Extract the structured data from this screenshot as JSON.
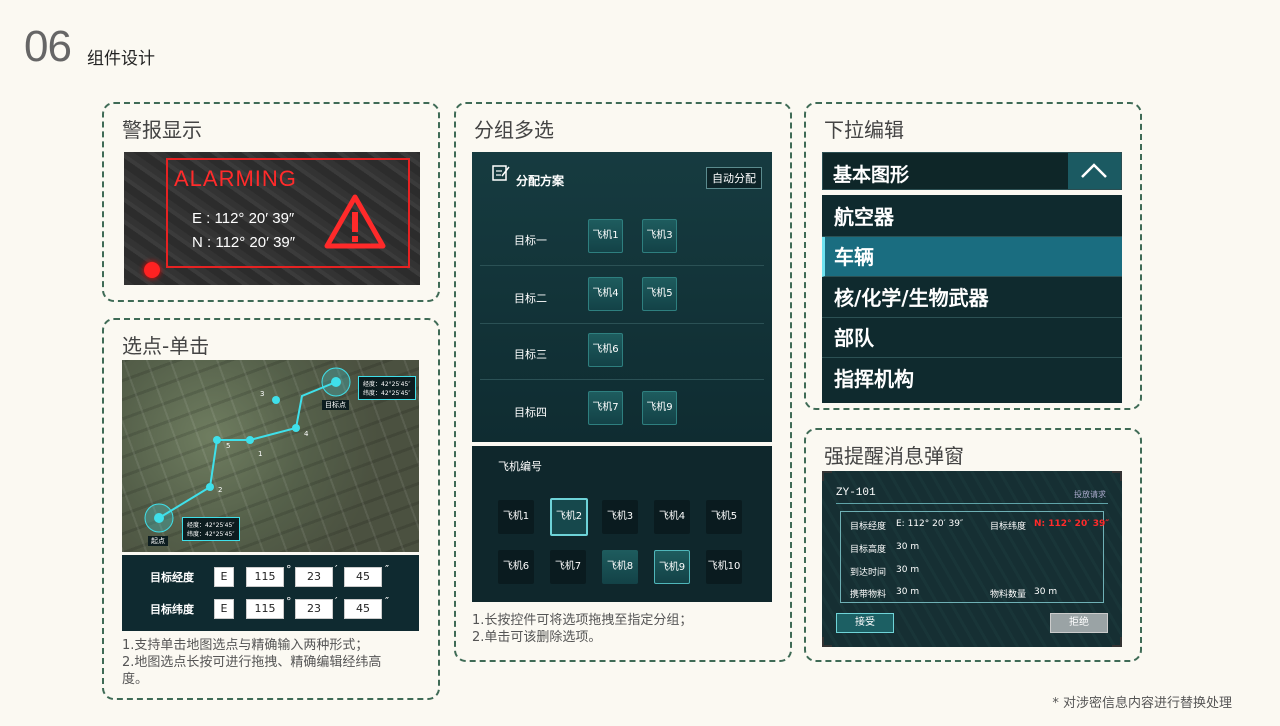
{
  "header": {
    "number": "06",
    "title": "组件设计"
  },
  "footnote": "* 对涉密信息内容进行替换处理",
  "alarm_card": {
    "title": "警报显示",
    "alarm_text": "ALARMING",
    "coord_e": "E : 112° 20′ 39″",
    "coord_n": "N : 112° 20′ 39″"
  },
  "point_card": {
    "title": "选点-单击",
    "map": {
      "start_label": "起点",
      "target_label": "目标点",
      "lon_label": "经度：42°25′45″",
      "lat_label": "纬度：42°25′45″",
      "waypoints": [
        "1",
        "2",
        "3",
        "4",
        "5"
      ]
    },
    "lon_row": {
      "label": "目标经度",
      "dir": "E",
      "deg": "115",
      "min": "23",
      "sec": "45",
      "u1": "°",
      "u2": "′",
      "u3": "″"
    },
    "lat_row": {
      "label": "目标纬度",
      "dir": "E",
      "deg": "115",
      "min": "23",
      "sec": "45",
      "u1": "°",
      "u2": "′",
      "u3": "″"
    },
    "notes": [
      "1.支持单击地图选点与精确输入两种形式；",
      "2.地图选点长按可进行拖拽、精确编辑经纬高",
      "度。"
    ]
  },
  "group_card": {
    "title": "分组多选",
    "panel_title": "分配方案",
    "auto_button": "自动分配",
    "groups": [
      {
        "label": "目标一",
        "planes": [
          "飞机1",
          "飞机3"
        ]
      },
      {
        "label": "目标二",
        "planes": [
          "飞机4",
          "飞机5"
        ]
      },
      {
        "label": "目标三",
        "planes": [
          "飞机6"
        ]
      },
      {
        "label": "目标四",
        "planes": [
          "飞机7",
          "飞机9"
        ]
      }
    ],
    "pool_title": "飞机编号",
    "pool": [
      "飞机1",
      "飞机2",
      "飞机3",
      "飞机4",
      "飞机5",
      "飞机6",
      "飞机7",
      "飞机8",
      "飞机9",
      "飞机10"
    ],
    "notes": [
      "1.长按控件可将选项拖拽至指定分组；",
      "2.单击可该删除选项。"
    ]
  },
  "dropdown_card": {
    "title": "下拉编辑",
    "selected": "基本图形",
    "items": [
      "航空器",
      "车辆",
      "核/化学/生物武器",
      "部队",
      "指挥机构"
    ],
    "active_item": "车辆"
  },
  "modal_card": {
    "title": "强提醒消息弹窗",
    "modal_title": "ZY-101",
    "modal_sub": "投放请求",
    "fields": {
      "lon_label": "目标经度",
      "lon_value": "E: 112° 20′ 39″",
      "lat_label": "目标纬度",
      "lat_value": "N: 112° 20′ 39″",
      "alt_label": "目标高度",
      "alt_value": "30 m",
      "time_label": "到达时间",
      "time_value": "30 m",
      "cargo_label": "携带物料",
      "cargo_value": "30 m",
      "count_label": "物料数量",
      "count_value": "30 m"
    },
    "accept": "接受",
    "reject": "拒绝"
  },
  "colors": {
    "accent": "#1a6d80",
    "alarm": "#e52222",
    "panel": "#0f2a2e",
    "border": "#3f6b56"
  }
}
